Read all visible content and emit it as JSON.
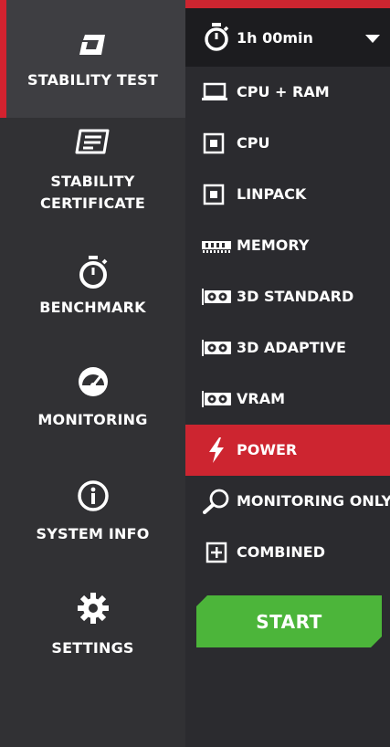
{
  "nav": {
    "items": [
      {
        "label": "STABILITY TEST",
        "icon": "stability-test-icon",
        "active": true
      },
      {
        "label": "STABILITY\nCERTIFICATE",
        "icon": "certificate-icon",
        "active": false
      },
      {
        "label": "BENCHMARK",
        "icon": "stopwatch-icon",
        "active": false
      },
      {
        "label": "MONITORING",
        "icon": "gauge-icon",
        "active": false
      },
      {
        "label": "SYSTEM INFO",
        "icon": "info-icon",
        "active": false
      },
      {
        "label": "SETTINGS",
        "icon": "gear-icon",
        "active": false
      }
    ]
  },
  "duration": {
    "value": "1h 00min",
    "icon": "stopwatch-icon"
  },
  "tests": [
    {
      "label": "CPU + RAM",
      "icon": "laptop-icon"
    },
    {
      "label": "CPU",
      "icon": "cpu-icon"
    },
    {
      "label": "LINPACK",
      "icon": "cpu-icon"
    },
    {
      "label": "MEMORY",
      "icon": "memory-icon"
    },
    {
      "label": "3D STANDARD",
      "icon": "gpu-icon"
    },
    {
      "label": "3D ADAPTIVE",
      "icon": "gpu-icon"
    },
    {
      "label": "VRAM",
      "icon": "gpu-icon"
    },
    {
      "label": "POWER",
      "icon": "lightning-icon",
      "active": true
    },
    {
      "label": "MONITORING ONLY",
      "icon": "magnifier-icon"
    },
    {
      "label": "COMBINED",
      "icon": "plus-box-icon"
    }
  ],
  "start_label": "START",
  "colors": {
    "accent_red": "#cd2530",
    "start_green": "#4cb53a",
    "nav_bg": "#313134",
    "panel_bg": "#2b2b2f"
  }
}
